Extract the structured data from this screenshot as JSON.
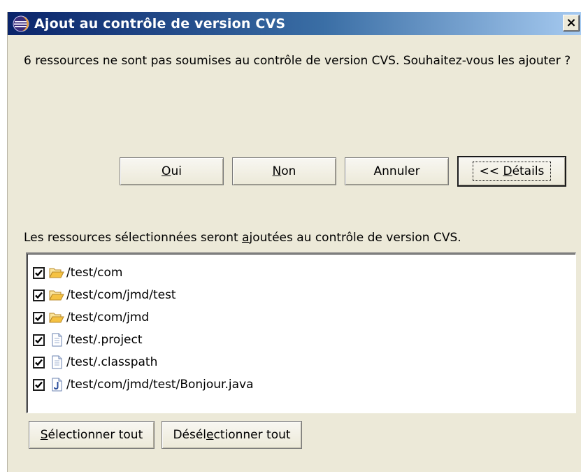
{
  "window": {
    "title": "Ajout au contrôle de version CVS",
    "close_glyph": "×"
  },
  "message": "6 ressources ne sont pas soumises au contrôle de version CVS. Souhaitez-vous les ajouter ?",
  "buttons": {
    "yes": {
      "pre": "",
      "mnemonic": "O",
      "post": "ui"
    },
    "no": {
      "pre": "",
      "mnemonic": "N",
      "post": "on"
    },
    "cancel": "Annuler",
    "details": {
      "pre": "<< ",
      "mnemonic": "D",
      "post": "étails"
    }
  },
  "selection_label": {
    "pre": "Les ressources sélectionnées seront ",
    "mnemonic": "a",
    "post": "joutées au contrôle de version CVS."
  },
  "resources": [
    {
      "path": "/test/com",
      "icon": "folder-open-icon",
      "checked": true
    },
    {
      "path": "/test/com/jmd/test",
      "icon": "folder-open-icon",
      "checked": true
    },
    {
      "path": "/test/com/jmd",
      "icon": "folder-open-icon",
      "checked": true
    },
    {
      "path": "/test/.project",
      "icon": "file-icon",
      "checked": true
    },
    {
      "path": "/test/.classpath",
      "icon": "file-icon",
      "checked": true
    },
    {
      "path": "/test/com/jmd/test/Bonjour.java",
      "icon": "java-file-icon",
      "checked": true
    }
  ],
  "select_all": {
    "pre": "",
    "mnemonic": "S",
    "post": "électionner tout"
  },
  "deselect_all": {
    "pre": "Désél",
    "mnemonic": "e",
    "post": "ctionner tout"
  },
  "colors": {
    "dialog_bg": "#ece9d8",
    "title_gradient_start": "#0a246a",
    "title_gradient_end": "#a6caf0",
    "folder_color": "#f5c242"
  }
}
